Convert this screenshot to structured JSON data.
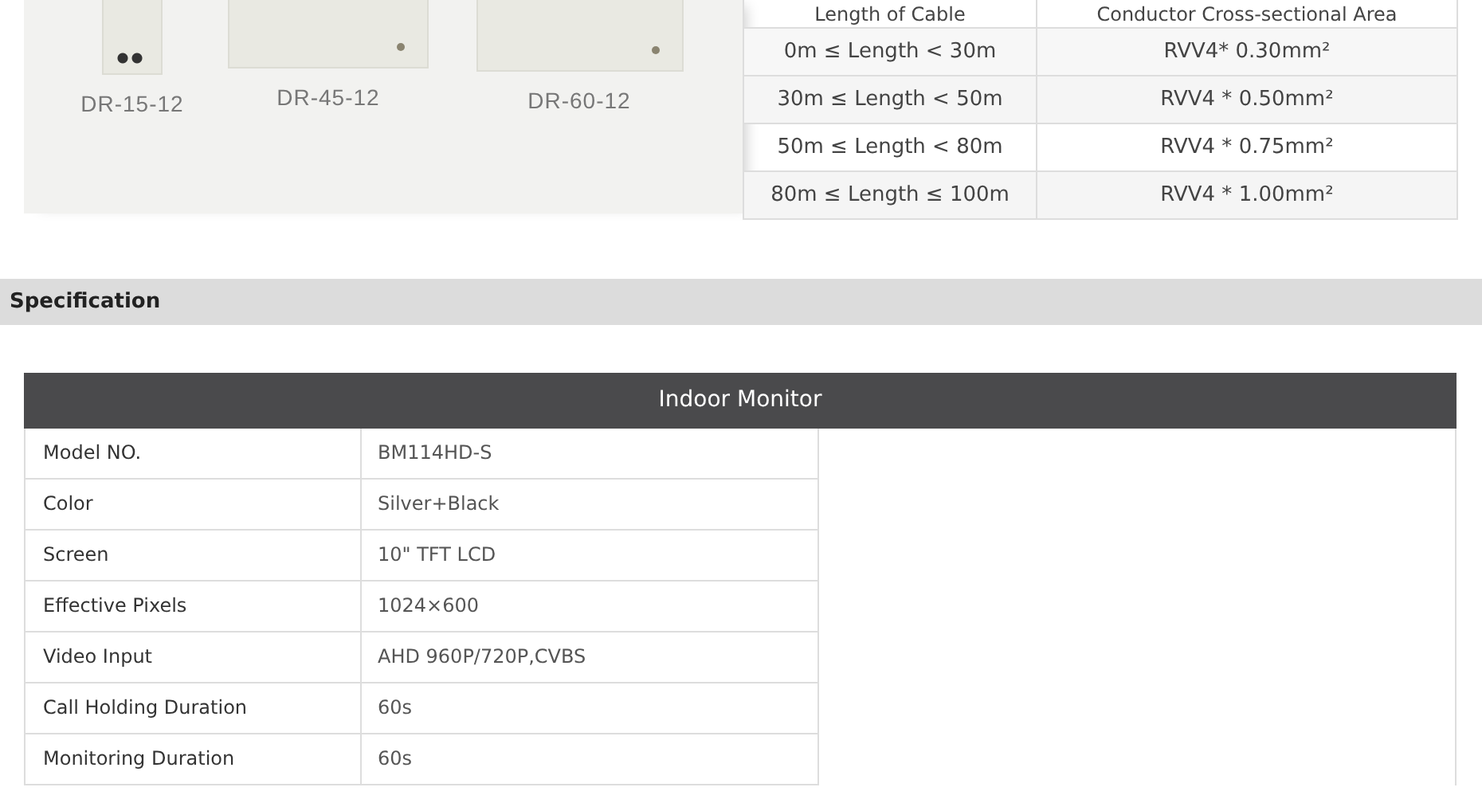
{
  "products": [
    {
      "caption": "DR-15-12",
      "kind": "narrow"
    },
    {
      "caption": "DR-45-12",
      "kind": "wide"
    },
    {
      "caption": "DR-60-12",
      "kind": "wide"
    }
  ],
  "cable_table": {
    "columns": [
      "Length of Cable",
      "Conductor Cross-sectional Area"
    ],
    "rows": [
      [
        "0m ≤ Length < 30m",
        "RVV4* 0.30mm²"
      ],
      [
        "30m ≤ Length < 50m",
        "RVV4 * 0.50mm²"
      ],
      [
        "50m ≤ Length < 80m",
        "RVV4 * 0.75mm²"
      ],
      [
        "80m ≤ Length ≤ 100m",
        "RVV4 * 1.00mm²"
      ]
    ]
  },
  "section_title": "Specification",
  "spec_table": {
    "title": "Indoor Monitor",
    "rows": [
      [
        "Model NO.",
        "BM114HD-S"
      ],
      [
        "Color",
        "Silver+Black"
      ],
      [
        "Screen",
        "10\" TFT LCD"
      ],
      [
        "Effective Pixels",
        "1024×600"
      ],
      [
        "Video Input",
        "AHD 960P/720P,CVBS"
      ],
      [
        "Call Holding Duration",
        "60s"
      ],
      [
        "Monitoring Duration",
        "60s"
      ]
    ]
  }
}
